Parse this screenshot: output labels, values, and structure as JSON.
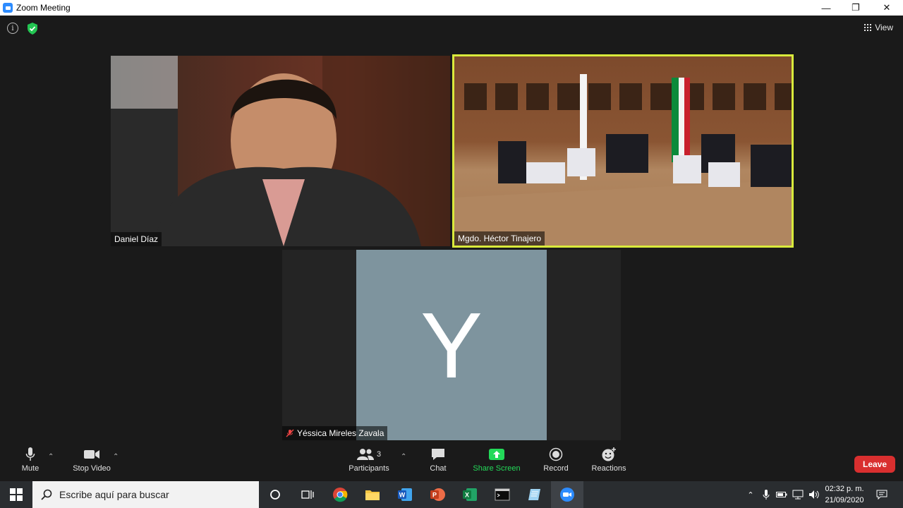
{
  "window": {
    "title": "Zoom Meeting",
    "minimize": "—",
    "restore": "❐",
    "close": "✕"
  },
  "header": {
    "view_label": "View"
  },
  "participants": [
    {
      "name": "Daniel Díaz"
    },
    {
      "name": "Mgdo. Héctor Tinajero"
    },
    {
      "name": "Yéssica Mireles Zavala",
      "initial": "Y"
    }
  ],
  "toolbar": {
    "mute": "Mute",
    "stop_video": "Stop Video",
    "participants": "Participants",
    "participants_count": "3",
    "chat": "Chat",
    "share_screen": "Share Screen",
    "record": "Record",
    "reactions": "Reactions",
    "leave": "Leave"
  },
  "taskbar": {
    "search_placeholder": "Escribe aquí para buscar",
    "time": "02:32 p. m.",
    "date": "21/09/2020"
  },
  "colors": {
    "active_speaker": "#d9ea3c",
    "leave": "#d92f2f",
    "share": "#23d959",
    "avatar": "#7e949e"
  }
}
